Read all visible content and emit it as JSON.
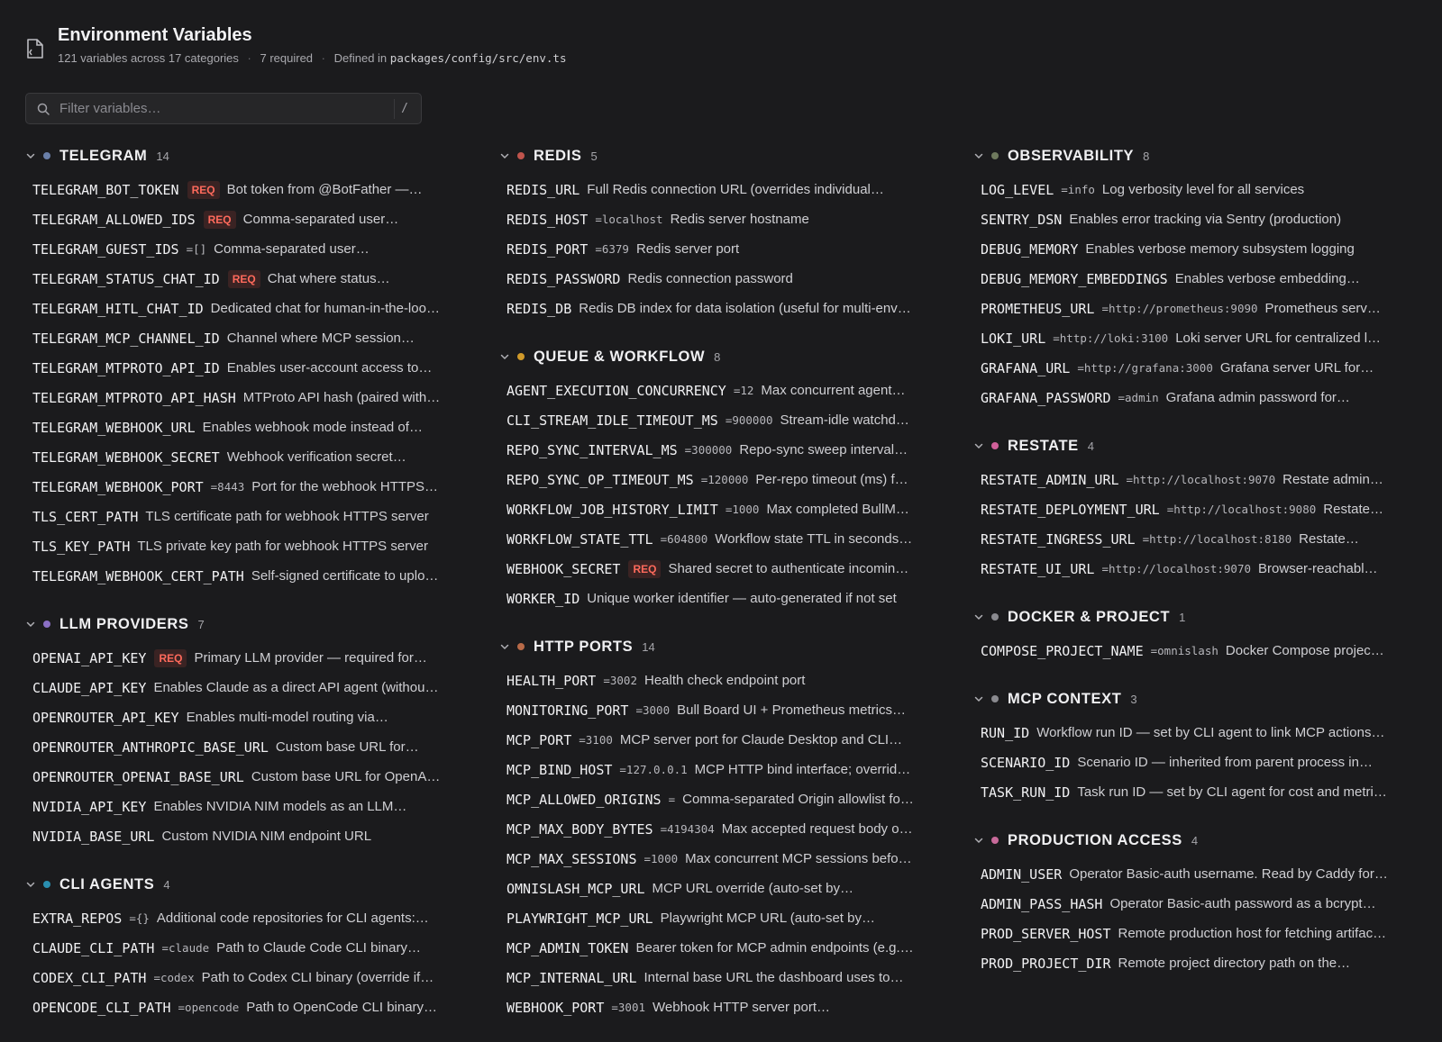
{
  "header": {
    "title": "Environment Variables",
    "count_text": "121 variables across 17 categories",
    "required_text": "7 required",
    "defined_prefix": "Defined in",
    "defined_path": "packages/config/src/env.ts",
    "sep": "·"
  },
  "search": {
    "placeholder": "Filter variables…",
    "shortcut": "/"
  },
  "req_badge": "REQ",
  "columns": [
    [
      {
        "name": "TELEGRAM",
        "count": "14",
        "color": "#6a7fa8",
        "items": [
          {
            "name": "TELEGRAM_BOT_TOKEN",
            "req": true,
            "desc": "Bot token from @BotFather —…"
          },
          {
            "name": "TELEGRAM_ALLOWED_IDS",
            "req": true,
            "desc": "Comma-separated user…"
          },
          {
            "name": "TELEGRAM_GUEST_IDS",
            "default": "=[]",
            "desc": "Comma-separated user…"
          },
          {
            "name": "TELEGRAM_STATUS_CHAT_ID",
            "req": true,
            "desc": "Chat where status…"
          },
          {
            "name": "TELEGRAM_HITL_CHAT_ID",
            "desc": "Dedicated chat for human-in-the-loo…"
          },
          {
            "name": "TELEGRAM_MCP_CHANNEL_ID",
            "desc": "Channel where MCP session…"
          },
          {
            "name": "TELEGRAM_MTPROTO_API_ID",
            "desc": "Enables user-account access to…"
          },
          {
            "name": "TELEGRAM_MTPROTO_API_HASH",
            "desc": "MTProto API hash (paired with…"
          },
          {
            "name": "TELEGRAM_WEBHOOK_URL",
            "desc": "Enables webhook mode instead of…"
          },
          {
            "name": "TELEGRAM_WEBHOOK_SECRET",
            "desc": "Webhook verification secret…"
          },
          {
            "name": "TELEGRAM_WEBHOOK_PORT",
            "default": "=8443",
            "desc": "Port for the webhook HTTPS…"
          },
          {
            "name": "TLS_CERT_PATH",
            "desc": "TLS certificate path for webhook HTTPS server"
          },
          {
            "name": "TLS_KEY_PATH",
            "desc": "TLS private key path for webhook HTTPS server"
          },
          {
            "name": "TELEGRAM_WEBHOOK_CERT_PATH",
            "desc": "Self-signed certificate to uplo…"
          }
        ]
      },
      {
        "name": "LLM PROVIDERS",
        "count": "7",
        "color": "#8a6fc4",
        "items": [
          {
            "name": "OPENAI_API_KEY",
            "req": true,
            "desc": "Primary LLM provider — required for…"
          },
          {
            "name": "CLAUDE_API_KEY",
            "desc": "Enables Claude as a direct API agent (withou…"
          },
          {
            "name": "OPENROUTER_API_KEY",
            "desc": "Enables multi-model routing via…"
          },
          {
            "name": "OPENROUTER_ANTHROPIC_BASE_URL",
            "desc": "Custom base URL for…"
          },
          {
            "name": "OPENROUTER_OPENAI_BASE_URL",
            "desc": "Custom base URL for OpenA…"
          },
          {
            "name": "NVIDIA_API_KEY",
            "desc": "Enables NVIDIA NIM models as an LLM…"
          },
          {
            "name": "NVIDIA_BASE_URL",
            "desc": "Custom NVIDIA NIM endpoint URL"
          }
        ]
      },
      {
        "name": "CLI AGENTS",
        "count": "4",
        "color": "#2a8fb0",
        "items": [
          {
            "name": "EXTRA_REPOS",
            "default": "={}",
            "desc": "Additional code repositories for CLI agents:…"
          },
          {
            "name": "CLAUDE_CLI_PATH",
            "default": "=claude",
            "desc": "Path to Claude Code CLI binary…"
          },
          {
            "name": "CODEX_CLI_PATH",
            "default": "=codex",
            "desc": "Path to Codex CLI binary (override if…"
          },
          {
            "name": "OPENCODE_CLI_PATH",
            "default": "=opencode",
            "desc": "Path to OpenCode CLI binary…"
          }
        ]
      }
    ],
    [
      {
        "name": "REDIS",
        "count": "5",
        "color": "#c0544c",
        "items": [
          {
            "name": "REDIS_URL",
            "desc": "Full Redis connection URL (overrides individual…"
          },
          {
            "name": "REDIS_HOST",
            "default": "=localhost",
            "desc": "Redis server hostname"
          },
          {
            "name": "REDIS_PORT",
            "default": "=6379",
            "desc": "Redis server port"
          },
          {
            "name": "REDIS_PASSWORD",
            "desc": "Redis connection password"
          },
          {
            "name": "REDIS_DB",
            "desc": "Redis DB index for data isolation (useful for multi-env…"
          }
        ]
      },
      {
        "name": "QUEUE & WORKFLOW",
        "count": "8",
        "color": "#d09a2a",
        "items": [
          {
            "name": "AGENT_EXECUTION_CONCURRENCY",
            "default": "=12",
            "desc": "Max concurrent agent…"
          },
          {
            "name": "CLI_STREAM_IDLE_TIMEOUT_MS",
            "default": "=900000",
            "desc": "Stream-idle watchd…"
          },
          {
            "name": "REPO_SYNC_INTERVAL_MS",
            "default": "=300000",
            "desc": "Repo-sync sweep interval…"
          },
          {
            "name": "REPO_SYNC_OP_TIMEOUT_MS",
            "default": "=120000",
            "desc": "Per-repo timeout (ms) f…"
          },
          {
            "name": "WORKFLOW_JOB_HISTORY_LIMIT",
            "default": "=1000",
            "desc": "Max completed BullM…"
          },
          {
            "name": "WORKFLOW_STATE_TTL",
            "default": "=604800",
            "desc": "Workflow state TTL in seconds…"
          },
          {
            "name": "WEBHOOK_SECRET",
            "req": true,
            "desc": "Shared secret to authenticate incomin…"
          },
          {
            "name": "WORKER_ID",
            "desc": "Unique worker identifier — auto-generated if not set"
          }
        ]
      },
      {
        "name": "HTTP PORTS",
        "count": "14",
        "color": "#b86a48",
        "items": [
          {
            "name": "HEALTH_PORT",
            "default": "=3002",
            "desc": "Health check endpoint port"
          },
          {
            "name": "MONITORING_PORT",
            "default": "=3000",
            "desc": "Bull Board UI + Prometheus metrics…"
          },
          {
            "name": "MCP_PORT",
            "default": "=3100",
            "desc": "MCP server port for Claude Desktop and CLI…"
          },
          {
            "name": "MCP_BIND_HOST",
            "default": "=127.0.0.1",
            "desc": "MCP HTTP bind interface; overrid…"
          },
          {
            "name": "MCP_ALLOWED_ORIGINS",
            "default": "=",
            "desc": "Comma-separated Origin allowlist fo…"
          },
          {
            "name": "MCP_MAX_BODY_BYTES",
            "default": "=4194304",
            "desc": "Max accepted request body o…"
          },
          {
            "name": "MCP_MAX_SESSIONS",
            "default": "=1000",
            "desc": "Max concurrent MCP sessions befo…"
          },
          {
            "name": "OMNISLASH_MCP_URL",
            "desc": "MCP URL override (auto-set by…"
          },
          {
            "name": "PLAYWRIGHT_MCP_URL",
            "desc": "Playwright MCP URL (auto-set by…"
          },
          {
            "name": "MCP_ADMIN_TOKEN",
            "desc": "Bearer token for MCP admin endpoints (e.g.…"
          },
          {
            "name": "MCP_INTERNAL_URL",
            "desc": "Internal base URL the dashboard uses to…"
          },
          {
            "name": "WEBHOOK_PORT",
            "default": "=3001",
            "desc": "Webhook HTTP server port…"
          }
        ]
      }
    ],
    [
      {
        "name": "OBSERVABILITY",
        "count": "8",
        "color": "#6f7a5e",
        "items": [
          {
            "name": "LOG_LEVEL",
            "default": "=info",
            "desc": "Log verbosity level for all services"
          },
          {
            "name": "SENTRY_DSN",
            "desc": "Enables error tracking via Sentry (production)"
          },
          {
            "name": "DEBUG_MEMORY",
            "desc": "Enables verbose memory subsystem logging"
          },
          {
            "name": "DEBUG_MEMORY_EMBEDDINGS",
            "desc": "Enables verbose embedding…"
          },
          {
            "name": "PROMETHEUS_URL",
            "default": "=http://prometheus:9090",
            "desc": "Prometheus serv…"
          },
          {
            "name": "LOKI_URL",
            "default": "=http://loki:3100",
            "desc": "Loki server URL for centralized l…"
          },
          {
            "name": "GRAFANA_URL",
            "default": "=http://grafana:3000",
            "desc": "Grafana server URL for…"
          },
          {
            "name": "GRAFANA_PASSWORD",
            "default": "=admin",
            "desc": "Grafana admin password for…"
          }
        ]
      },
      {
        "name": "RESTATE",
        "count": "4",
        "color": "#d0609a",
        "items": [
          {
            "name": "RESTATE_ADMIN_URL",
            "default": "=http://localhost:9070",
            "desc": "Restate admin…"
          },
          {
            "name": "RESTATE_DEPLOYMENT_URL",
            "default": "=http://localhost:9080",
            "desc": "Restate…"
          },
          {
            "name": "RESTATE_INGRESS_URL",
            "default": "=http://localhost:8180",
            "desc": "Restate…"
          },
          {
            "name": "RESTATE_UI_URL",
            "default": "=http://localhost:9070",
            "desc": "Browser-reachabl…"
          }
        ]
      },
      {
        "name": "DOCKER & PROJECT",
        "count": "1",
        "color": "#8a8a8f",
        "items": [
          {
            "name": "COMPOSE_PROJECT_NAME",
            "default": "=omnislash",
            "desc": "Docker Compose projec…"
          }
        ]
      },
      {
        "name": "MCP CONTEXT",
        "count": "3",
        "color": "#8a8a8f",
        "items": [
          {
            "name": "RUN_ID",
            "desc": "Workflow run ID — set by CLI agent to link MCP actions…"
          },
          {
            "name": "SCENARIO_ID",
            "desc": "Scenario ID — inherited from parent process in…"
          },
          {
            "name": "TASK_RUN_ID",
            "desc": "Task run ID — set by CLI agent for cost and metri…"
          }
        ]
      },
      {
        "name": "PRODUCTION ACCESS",
        "count": "4",
        "color": "#c86a9a",
        "items": [
          {
            "name": "ADMIN_USER",
            "desc": "Operator Basic-auth username. Read by Caddy for…"
          },
          {
            "name": "ADMIN_PASS_HASH",
            "desc": "Operator Basic-auth password as a bcrypt…"
          },
          {
            "name": "PROD_SERVER_HOST",
            "desc": "Remote production host for fetching artifac…"
          },
          {
            "name": "PROD_PROJECT_DIR",
            "desc": "Remote project directory path on the…"
          }
        ]
      }
    ]
  ]
}
